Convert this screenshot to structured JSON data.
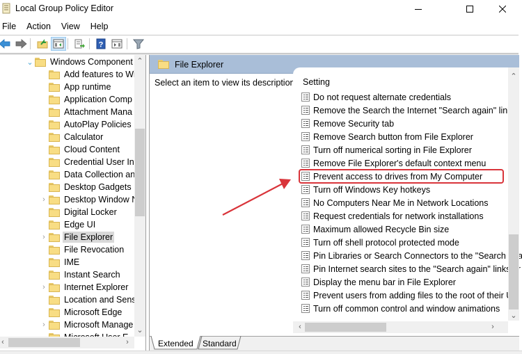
{
  "window": {
    "title": "Local Group Policy Editor",
    "controls": {
      "minimize": "minimize",
      "maximize": "maximize",
      "close": "close"
    }
  },
  "menu": [
    "File",
    "Action",
    "View",
    "Help"
  ],
  "toolbar": {
    "buttons": [
      {
        "name": "back",
        "icon": "back-arrow-icon"
      },
      {
        "name": "forward",
        "icon": "forward-arrow-icon"
      },
      {
        "name": "up-one-level",
        "icon": "folder-up-icon"
      },
      {
        "name": "show-hide-console-tree",
        "icon": "console-tree-icon",
        "active": true
      },
      {
        "name": "export-list",
        "icon": "export-list-icon"
      },
      {
        "name": "help",
        "icon": "help-icon"
      },
      {
        "name": "show-hide-action-pane",
        "icon": "action-pane-icon"
      },
      {
        "name": "filter",
        "icon": "filter-icon"
      }
    ]
  },
  "tree": {
    "parent": {
      "label": "Windows Component",
      "expanded": true
    },
    "items": [
      {
        "label": "Add features to Wi",
        "expandable": false
      },
      {
        "label": "App runtime",
        "expandable": false
      },
      {
        "label": "Application Comp",
        "expandable": false
      },
      {
        "label": "Attachment Mana",
        "expandable": false
      },
      {
        "label": "AutoPlay Policies",
        "expandable": false
      },
      {
        "label": "Calculator",
        "expandable": false
      },
      {
        "label": "Cloud Content",
        "expandable": false
      },
      {
        "label": "Credential User Int",
        "expandable": false
      },
      {
        "label": "Data Collection an",
        "expandable": false
      },
      {
        "label": "Desktop Gadgets",
        "expandable": false
      },
      {
        "label": "Desktop Window N",
        "expandable": true
      },
      {
        "label": "Digital Locker",
        "expandable": false
      },
      {
        "label": "Edge UI",
        "expandable": false
      },
      {
        "label": "File Explorer",
        "expandable": true,
        "selected": true
      },
      {
        "label": "File Revocation",
        "expandable": false
      },
      {
        "label": "IME",
        "expandable": false
      },
      {
        "label": "Instant Search",
        "expandable": false
      },
      {
        "label": "Internet Explorer",
        "expandable": true
      },
      {
        "label": "Location and Sens",
        "expandable": false
      },
      {
        "label": "Microsoft Edge",
        "expandable": false
      },
      {
        "label": "Microsoft Manage",
        "expandable": true
      },
      {
        "label": "Microsoft User E",
        "expandable": false
      }
    ]
  },
  "details": {
    "header_title": "File Explorer",
    "description": "Select an item to view its description.",
    "column_header": "Setting",
    "settings": [
      "Do not request alternate credentials",
      "Remove the Search the Internet \"Search again\" link",
      "Remove Security tab",
      "Remove Search button from File Explorer",
      "Turn off numerical sorting in File Explorer",
      "Remove File Explorer's default context menu",
      "Prevent access to drives from My Computer",
      "Turn off Windows Key hotkeys",
      "No Computers Near Me in Network Locations",
      "Request credentials for network installations",
      "Maximum allowed Recycle Bin size",
      "Turn off shell protocol protected mode",
      "Pin Libraries or Search Connectors to the \"Search aga",
      "Pin Internet search sites to the \"Search again\" links ar",
      "Display the menu bar in File Explorer",
      "Prevent users from adding files to the root of their Us",
      "Turn off common control and window animations"
    ],
    "highlighted_setting": "Prevent access to drives from My Computer",
    "annotation_color": "#d9343a"
  },
  "view_tabs": [
    {
      "label": "Extended",
      "active": true
    },
    {
      "label": "Standard",
      "active": false
    }
  ]
}
